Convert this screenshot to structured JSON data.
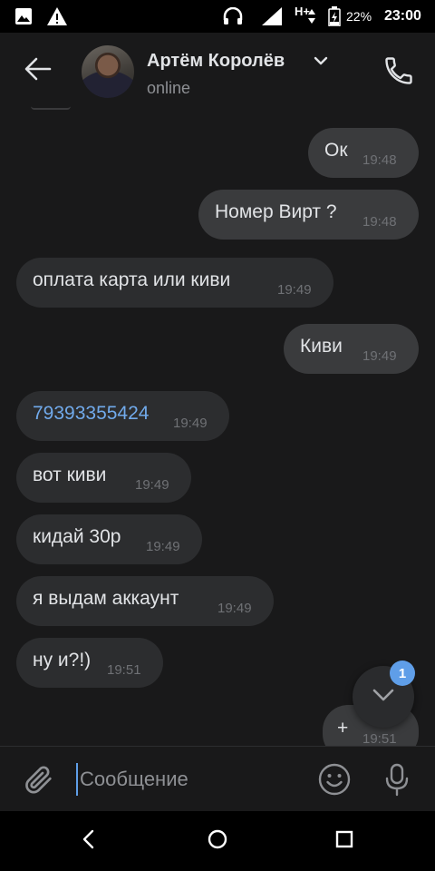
{
  "status_bar": {
    "network": "H+",
    "battery": "22%",
    "time": "23:00",
    "icons": [
      "image-icon",
      "warning-icon",
      "headphones-icon",
      "signal-icon",
      "battery-charging-icon"
    ]
  },
  "header": {
    "contact_name": "Артём Королёв",
    "status": "online",
    "icons": [
      "back-arrow-icon",
      "chevron-down-icon",
      "phone-icon"
    ]
  },
  "messages": [
    {
      "direction": "out",
      "text": "Ок",
      "time": "19:48"
    },
    {
      "direction": "out",
      "text": "Номер Вирт ?",
      "time": "19:48"
    },
    {
      "direction": "in",
      "text": "оплата карта или киви",
      "time": "19:49"
    },
    {
      "direction": "out",
      "text": "Киви",
      "time": "19:49"
    },
    {
      "direction": "in",
      "text": "79393355424",
      "time": "19:49",
      "is_link": true
    },
    {
      "direction": "in",
      "text": "вот киви",
      "time": "19:49"
    },
    {
      "direction": "in",
      "text": "кидай 30р",
      "time": "19:49"
    },
    {
      "direction": "in",
      "text": "я выдам аккаунт",
      "time": "19:49"
    },
    {
      "direction": "in",
      "text": "ну и?!)",
      "time": "19:51"
    },
    {
      "direction": "out",
      "text": "+",
      "time": "19:51"
    }
  ],
  "scroll_down": {
    "badge": "1",
    "icon": "chevron-down-icon"
  },
  "composer": {
    "placeholder": "Сообщение",
    "value": "",
    "icons": [
      "paperclip-icon",
      "emoji-icon",
      "microphone-icon"
    ]
  },
  "nav_bar": {
    "icons": [
      "nav-back-icon",
      "nav-home-icon",
      "nav-recents-icon"
    ]
  },
  "colors": {
    "background": "#19191a",
    "bubble": "#2c2d2f",
    "link": "#71aaeb",
    "accent": "#5f9ee8"
  }
}
